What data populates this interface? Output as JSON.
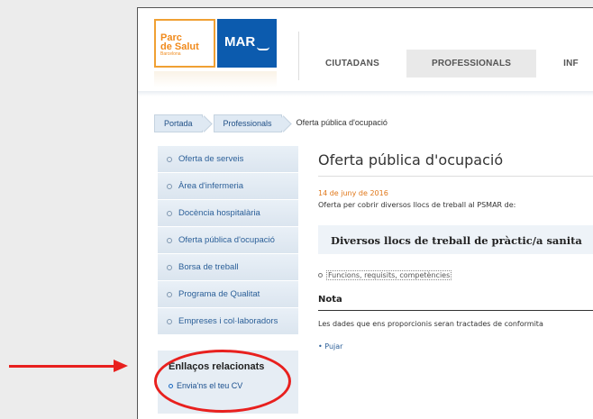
{
  "header": {
    "logo_parc_line1": "Parc",
    "logo_parc_line2": "de Salut",
    "logo_parc_line3": "Barcelona",
    "logo_mar": "MAR",
    "nav": [
      "CIUTADANS",
      "PROFESSIONALS",
      "INF"
    ]
  },
  "breadcrumb": [
    "Portada",
    "Professionals",
    "Oferta pública d'ocupació"
  ],
  "sidebar": {
    "items": [
      "Oferta de serveis",
      "Àrea d'infermeria",
      "Docència hospitalària",
      "Oferta pública d'ocupació",
      "Borsa de treball",
      "Programa de Qualitat",
      "Empreses i col·laboradors"
    ],
    "related_title": "Enllaços relacionats",
    "related_link": "Envia'ns el teu CV"
  },
  "main": {
    "title": "Oferta pública d'ocupació",
    "date": "14 de juny de 2016",
    "intro": "Oferta per cobrir diversos llocs de treball al PSMAR de:",
    "job_title": "Diversos llocs de treball de pràctic/a sanita",
    "functions_link": "Funcions, requisits, competències",
    "nota_title": "Nota",
    "nota_text": "Les dades que ens proporcionis seran tractades de conformita",
    "pujar": "• Pujar"
  },
  "colors": {
    "accent_orange": "#f08a1c",
    "brand_blue": "#0c5bae",
    "annotation_red": "#e8201e"
  }
}
